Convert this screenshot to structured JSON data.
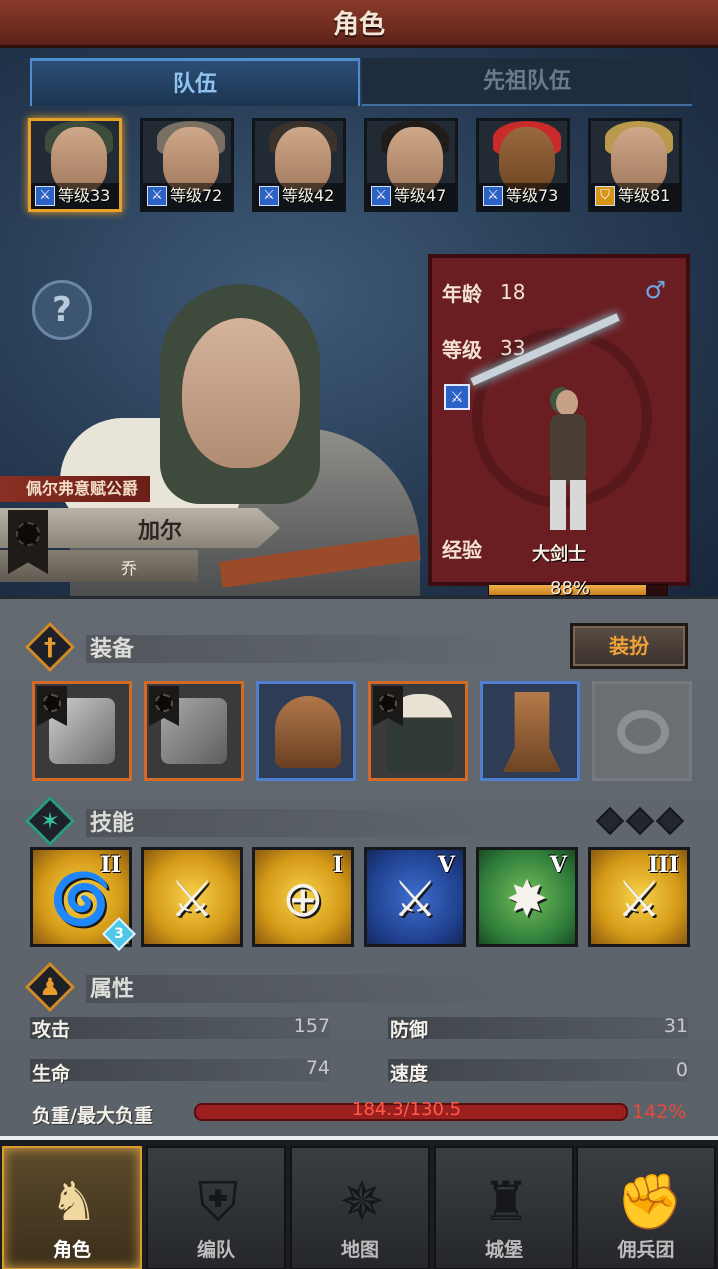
{
  "header": {
    "title": "角色"
  },
  "tabs": {
    "party": "队伍",
    "ancestor_party": "先祖队伍"
  },
  "roster": [
    {
      "level_label": "等级33",
      "class_icon": "sword-icon",
      "hair": "#3e4d3b",
      "selected": true
    },
    {
      "level_label": "等级72",
      "class_icon": "sword-icon",
      "hair": "#7a6f63",
      "selected": false
    },
    {
      "level_label": "等级42",
      "class_icon": "sword-icon",
      "hair": "#3a322c",
      "selected": false
    },
    {
      "level_label": "等级47",
      "class_icon": "sword-icon",
      "hair": "#1f1c1a",
      "selected": false
    },
    {
      "level_label": "等级73",
      "class_icon": "sword-icon",
      "hair": "#c92a2a",
      "selected": false
    },
    {
      "level_label": "等级81",
      "class_icon": "shield-icon",
      "hair": "#b99a4c",
      "selected": false
    }
  ],
  "hero": {
    "title_banner": "佩尔弗意赋公爵",
    "name": "加尔",
    "subname": "乔"
  },
  "stats_card": {
    "age_label": "年龄",
    "age": "18",
    "level_label": "等级",
    "level": "33",
    "class_name": "大剑士",
    "xp_label": "经验",
    "xp_percent_text": "88%",
    "xp_fraction": 0.88
  },
  "equipment": {
    "label": "装备",
    "dress_button": "装扮"
  },
  "skills": {
    "label": "技能",
    "items": [
      {
        "rank": "II",
        "style": "gold",
        "glyph": "🌀",
        "stack": "3"
      },
      {
        "rank": "",
        "style": "gold",
        "glyph": "⚔",
        "stack": ""
      },
      {
        "rank": "I",
        "style": "gold",
        "glyph": "⊕",
        "stack": ""
      },
      {
        "rank": "V",
        "style": "blue",
        "glyph": "⚔",
        "stack": ""
      },
      {
        "rank": "V",
        "style": "green",
        "glyph": "✸",
        "stack": ""
      },
      {
        "rank": "III",
        "style": "gold",
        "glyph": "⚔",
        "stack": ""
      }
    ]
  },
  "attributes": {
    "label": "属性",
    "attack_label": "攻击",
    "attack": "157",
    "defense_label": "防御",
    "defense": "31",
    "hp_label": "生命",
    "hp": "74",
    "speed_label": "速度",
    "speed": "0",
    "load_label": "负重/最大负重",
    "load_value": "184.3/130.5",
    "load_percent": "142%"
  },
  "nav": {
    "character": "角色",
    "formation": "编队",
    "map": "地图",
    "castle": "城堡",
    "mercenary": "佣兵团"
  },
  "colors": {
    "accent_gold": "#d89c2c",
    "banner_red": "#6b1e22",
    "overload_red": "#e84a3a"
  }
}
